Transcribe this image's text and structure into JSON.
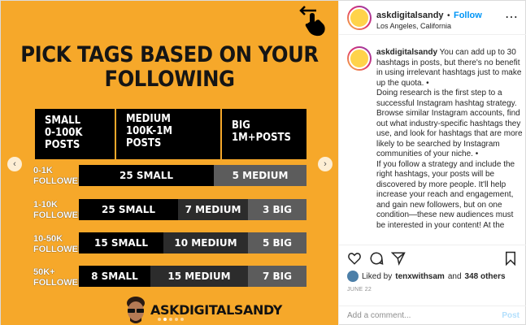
{
  "post": {
    "headline_line1": "PICK TAGS BASED ON YOUR",
    "headline_line2": "FOLLOWING",
    "headers": [
      "SMALL\n0-100K\nPOSTS",
      "MEDIUM\n100K-1M\nPOSTS",
      "BIG\n1M+POSTS"
    ],
    "header_small": [
      "SMALL",
      "0-100K",
      "POSTS"
    ],
    "header_medium": [
      "MEDIUM",
      "100K-1M",
      "POSTS"
    ],
    "header_big": [
      "BIG",
      "1M+POSTS"
    ],
    "rows": [
      {
        "label1": "0-1K",
        "label2": "FOLLOWERS",
        "small": "25 SMALL",
        "medium": "5 MEDIUM",
        "big": ""
      },
      {
        "label1": "1-10K",
        "label2": "FOLLOWERS",
        "small": "25 SMALL",
        "medium": "7 MEDIUM",
        "big": "3 BIG"
      },
      {
        "label1": "10-50K",
        "label2": "FOLLOWERS",
        "small": "15 SMALL",
        "medium": "10 MEDIUM",
        "big": "5 BIG"
      },
      {
        "label1": "50K+",
        "label2": "FOLLOWERS",
        "small": "8 SMALL",
        "medium": "15 MEDIUM",
        "big": "7 BIG"
      }
    ],
    "brand": "ASKDIGITALSANDY",
    "colors": {
      "background": "#f6a82a",
      "small": "#000000",
      "medium": "#2c2c2c",
      "big": "#5c5c5c"
    }
  },
  "sidebar": {
    "username": "askdigitalsandy",
    "separator": "•",
    "follow_label": "Follow",
    "location": "Los Angeles, California",
    "more_icon": "⋯",
    "caption_user": "askdigitalsandy",
    "caption_text": "You can add up to 30 hashtags in posts, but there's no benefit in using irrelevant hashtags just to make up the quota. •\nDoing research is the first step to a successful Instagram hashtag strategy. Browse similar Instagram accounts, find out what industry-specific hashtags they use, and look for hashtags that are more likely to be searched by Instagram communities of your niche. •\nIf you follow a strategy and include the right hashtags, your posts will be discovered by more people. It'll help increase your reach and engagement, and gain new followers, but on one condition—these new audiences must be interested in your content! At the",
    "liked_prefix": "Liked by",
    "liked_user": "tenxwithsam",
    "liked_and": "and",
    "liked_count": "348 others",
    "date": "JUNE 22",
    "comment_placeholder": "Add a comment...",
    "post_label": "Post"
  }
}
